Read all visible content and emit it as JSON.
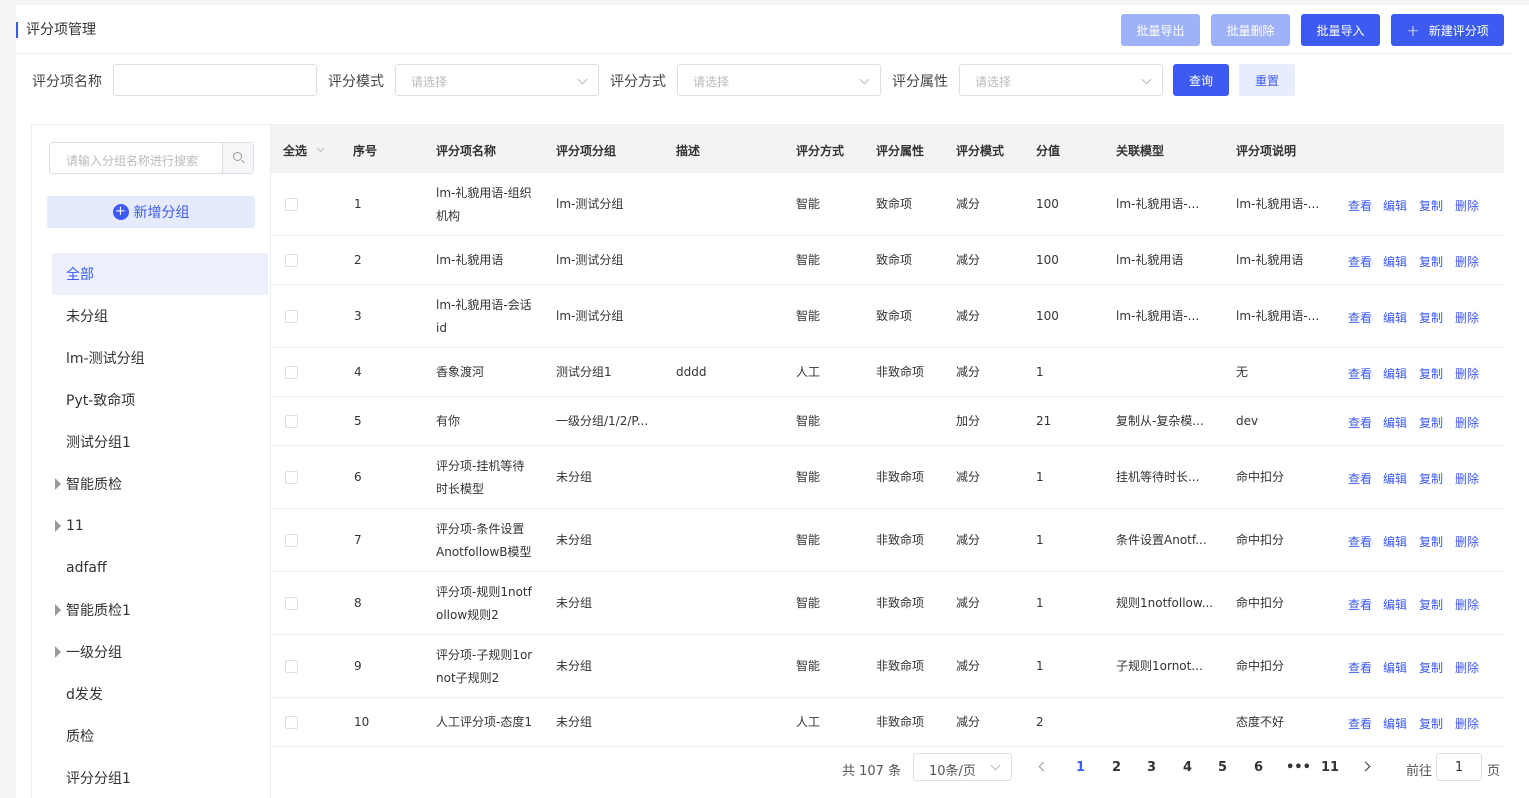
{
  "page": {
    "title": "评分项管理"
  },
  "toolbar": {
    "export_label": "批量导出",
    "delete_label": "批量删除",
    "import_label": "批量导入",
    "new_label": "新建评分项",
    "new_icon": "+"
  },
  "filters": {
    "name_label": "评分项名称",
    "name_value": "",
    "mode_label": "评分模式",
    "mode_placeholder": "请选择",
    "method_label": "评分方式",
    "method_placeholder": "请选择",
    "attr_label": "评分属性",
    "attr_placeholder": "请选择",
    "query_label": "查询",
    "reset_label": "重置"
  },
  "sidebar": {
    "search_placeholder": "请输入分组名称进行搜索",
    "add_group_label": "新增分组",
    "add_group_icon": "+",
    "items": [
      {
        "label": "全部",
        "active": true,
        "expandable": false
      },
      {
        "label": "未分组",
        "active": false,
        "expandable": false
      },
      {
        "label": "lm-测试分组",
        "active": false,
        "expandable": false
      },
      {
        "label": "Pyt-致命项",
        "active": false,
        "expandable": false
      },
      {
        "label": "测试分组1",
        "active": false,
        "expandable": false
      },
      {
        "label": "智能质检",
        "active": false,
        "expandable": true
      },
      {
        "label": "11",
        "active": false,
        "expandable": true
      },
      {
        "label": "adfaff",
        "active": false,
        "expandable": false
      },
      {
        "label": "智能质检1",
        "active": false,
        "expandable": true
      },
      {
        "label": "一级分组",
        "active": false,
        "expandable": true
      },
      {
        "label": "d发发",
        "active": false,
        "expandable": false
      },
      {
        "label": "质检",
        "active": false,
        "expandable": false
      },
      {
        "label": "评分分组1",
        "active": false,
        "expandable": false
      }
    ]
  },
  "table": {
    "headers": {
      "select_all": "全选",
      "index": "序号",
      "name": "评分项名称",
      "group": "评分项分组",
      "desc": "描述",
      "method": "评分方式",
      "attr": "评分属性",
      "mode": "评分模式",
      "score": "分值",
      "model": "关联模型",
      "note": "评分项说明"
    },
    "actions": {
      "view": "查看",
      "edit": "编辑",
      "copy": "复制",
      "delete": "删除"
    },
    "rows": [
      {
        "index": "1",
        "name": [
          "lm-礼貌用语-组织",
          "机构"
        ],
        "group": "lm-测试分组",
        "desc": "",
        "method": "智能",
        "attr": "致命项",
        "mode": "减分",
        "score": "100",
        "model": "lm-礼貌用语-...",
        "note": "lm-礼貌用语-..."
      },
      {
        "index": "2",
        "name": [
          "lm-礼貌用语"
        ],
        "group": "lm-测试分组",
        "desc": "",
        "method": "智能",
        "attr": "致命项",
        "mode": "减分",
        "score": "100",
        "model": "lm-礼貌用语",
        "note": "lm-礼貌用语"
      },
      {
        "index": "3",
        "name": [
          "lm-礼貌用语-会话",
          "id"
        ],
        "group": "lm-测试分组",
        "desc": "",
        "method": "智能",
        "attr": "致命项",
        "mode": "减分",
        "score": "100",
        "model": "lm-礼貌用语-...",
        "note": "lm-礼貌用语-..."
      },
      {
        "index": "4",
        "name": [
          "香象渡河"
        ],
        "group": "测试分组1",
        "desc": "dddd",
        "method": "人工",
        "attr": "非致命项",
        "mode": "减分",
        "score": "1",
        "model": "",
        "note": "无"
      },
      {
        "index": "5",
        "name": [
          "有你"
        ],
        "group": "一级分组/1/2/P...",
        "desc": "",
        "method": "智能",
        "attr": "",
        "mode": "加分",
        "score": "21",
        "model": "复制从-复杂模...",
        "note": "dev"
      },
      {
        "index": "6",
        "name": [
          "评分项-挂机等待",
          "时长模型"
        ],
        "group": "未分组",
        "desc": "",
        "method": "智能",
        "attr": "非致命项",
        "mode": "减分",
        "score": "1",
        "model": "挂机等待时长...",
        "note": "命中扣分"
      },
      {
        "index": "7",
        "name": [
          "评分项-条件设置",
          "AnotfollowB模型"
        ],
        "group": "未分组",
        "desc": "",
        "method": "智能",
        "attr": "非致命项",
        "mode": "减分",
        "score": "1",
        "model": "条件设置Anotf...",
        "note": "命中扣分"
      },
      {
        "index": "8",
        "name": [
          "评分项-规则1notf",
          "ollow规则2"
        ],
        "group": "未分组",
        "desc": "",
        "method": "智能",
        "attr": "非致命项",
        "mode": "减分",
        "score": "1",
        "model": "规则1notfollow...",
        "note": "命中扣分"
      },
      {
        "index": "9",
        "name": [
          "评分项-子规则1or",
          "not子规则2"
        ],
        "group": "未分组",
        "desc": "",
        "method": "智能",
        "attr": "非致命项",
        "mode": "减分",
        "score": "1",
        "model": "子规则1ornot...",
        "note": "命中扣分"
      },
      {
        "index": "10",
        "name": [
          "人工评分项-态度1"
        ],
        "group": "未分组",
        "desc": "",
        "method": "人工",
        "attr": "非致命项",
        "mode": "减分",
        "score": "2",
        "model": "",
        "note": "态度不好"
      }
    ]
  },
  "pagination": {
    "total": "共 107 条",
    "page_size": "10条/页",
    "pages": [
      "1",
      "2",
      "3",
      "4",
      "5",
      "6",
      "•••",
      "11"
    ],
    "current": "1",
    "goto_prefix": "前往",
    "goto_value": "1",
    "goto_suffix": "页"
  }
}
